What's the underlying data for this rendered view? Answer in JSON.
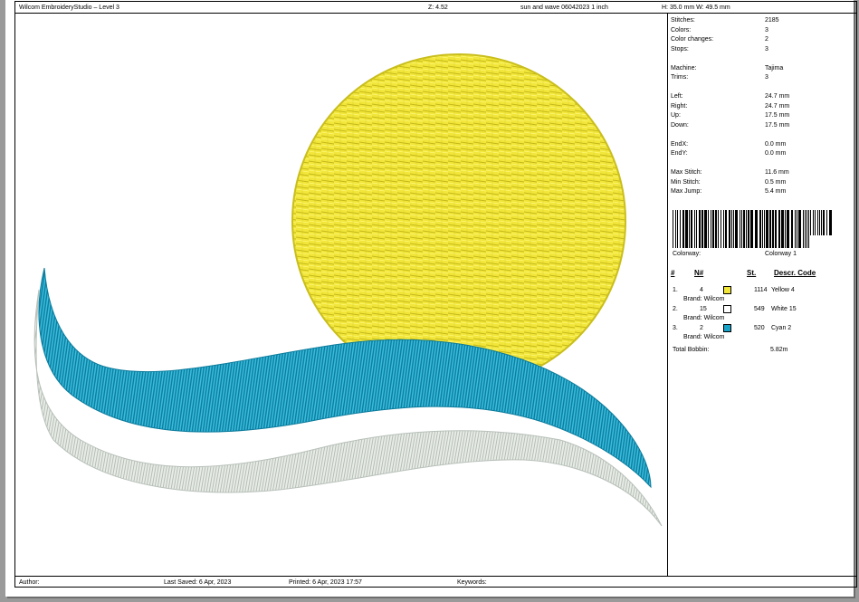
{
  "header": {
    "app": "Wilcom EmbroideryStudio – Level 3",
    "zoom": "Z: 4.52",
    "design_name": "sun and wave 06042023 1 inch",
    "size": "H: 35.0 mm   W: 49.5 mm"
  },
  "stats": [
    {
      "label": "Stitches:",
      "value": "2185"
    },
    {
      "label": "Colors:",
      "value": "3"
    },
    {
      "label": "Color changes:",
      "value": "2"
    },
    {
      "label": "Stops:",
      "value": "3"
    },
    {
      "label": "Machine:",
      "value": "Tajima"
    },
    {
      "label": "Trims:",
      "value": "3"
    },
    {
      "label": "Left:",
      "value": "24.7 mm"
    },
    {
      "label": "Right:",
      "value": "24.7 mm"
    },
    {
      "label": "Up:",
      "value": "17.5 mm"
    },
    {
      "label": "Down:",
      "value": "17.5 mm"
    },
    {
      "label": "EndX:",
      "value": "0.0 mm"
    },
    {
      "label": "EndY:",
      "value": "0.0 mm"
    },
    {
      "label": "Max Stitch:",
      "value": "11.6 mm"
    },
    {
      "label": "Min Stitch:",
      "value": "0.5 mm"
    },
    {
      "label": "Max Jump:",
      "value": "5.4 mm"
    }
  ],
  "colorway": {
    "label": "Colorway:",
    "value": "Colorway 1"
  },
  "table": {
    "headers": {
      "num": "#",
      "needle": "N#",
      "stitches": "St.",
      "desc": "Descr. Code"
    },
    "rows": [
      {
        "num": "1.",
        "needle": "4",
        "stitches": "1114",
        "desc": "Yellow 4",
        "brand": "Brand: Wilcom",
        "color": "#f2e63a"
      },
      {
        "num": "2.",
        "needle": "15",
        "stitches": "549",
        "desc": "White 15",
        "brand": "Brand: Wilcom",
        "color": "#ffffff"
      },
      {
        "num": "3.",
        "needle": "2",
        "stitches": "520",
        "desc": "Cyan 2",
        "brand": "Brand: Wilcom",
        "color": "#1aa3c8"
      }
    ],
    "total_label": "Total Bobbin:",
    "total_value": "5.82m"
  },
  "footer": {
    "author": "Author:",
    "last_saved": "Last Saved:  6 Apr, 2023",
    "printed": "Printed:  6 Apr, 2023 17:57",
    "keywords": "Keywords:"
  },
  "design_colors": {
    "sun": "#f2e63a",
    "wave_blue": "#1aa3c8",
    "wave_white": "#e8ece6"
  }
}
